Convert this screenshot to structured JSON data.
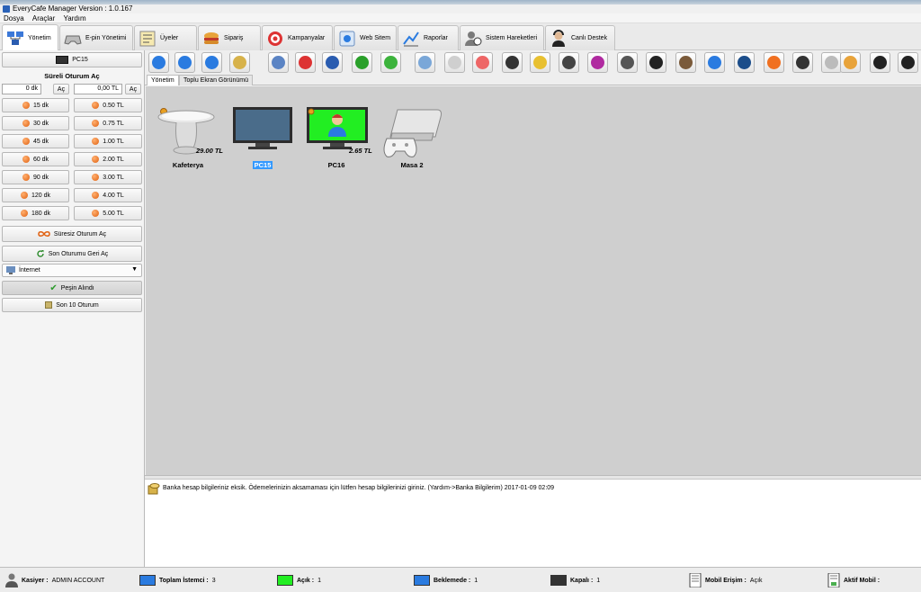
{
  "window": {
    "title": "EveryCafe Manager Version : 1.0.167"
  },
  "menu": [
    "Dosya",
    "Araçlar",
    "Yardım"
  ],
  "tabs": [
    {
      "label": "Yönetim",
      "icon": "network-icon",
      "active": true
    },
    {
      "label": "E-pin Yönetimi",
      "icon": "gamepad-icon"
    },
    {
      "label": "Üyeler",
      "icon": "member-list-icon"
    },
    {
      "label": "Sipariş",
      "icon": "burger-icon"
    },
    {
      "label": "Kampanyalar",
      "icon": "target-icon"
    },
    {
      "label": "Web Sitem",
      "icon": "web-icon"
    },
    {
      "label": "Raporlar",
      "icon": "report-icon"
    },
    {
      "label": "Sistem Hareketleri",
      "icon": "users-activity-icon"
    },
    {
      "label": "Canlı Destek",
      "icon": "support-icon"
    }
  ],
  "left": {
    "pc_button": "PC15",
    "section_title": "Süreli Oturum Aç",
    "minutes_value": "0 dk",
    "amount_value": "0,00 TL",
    "open_label": "Aç",
    "time_buttons": [
      "15 dk",
      "30 dk",
      "45 dk",
      "60 dk",
      "90 dk",
      "120 dk",
      "180 dk"
    ],
    "money_buttons": [
      "0.50 TL",
      "0.75 TL",
      "1.00 TL",
      "2.00 TL",
      "3.00 TL",
      "4.00 TL",
      "5.00 TL"
    ],
    "unlimited_label": "Süresiz Oturum Aç",
    "restore_label": "Son Oturumu Geri Aç",
    "select_value": "İnternet",
    "paid_label": "Peşin Alındı",
    "last10_label": "Son 10 Oturum"
  },
  "subtabs": [
    "Yönetim",
    "Toplu Ekran Görünümü"
  ],
  "clients": [
    {
      "name": "Kafeterya",
      "price": "29.00 TL",
      "kind": "cafe"
    },
    {
      "name": "PC15",
      "price": "",
      "kind": "monitor-off",
      "selected": true
    },
    {
      "name": "PC16",
      "price": "2.65 TL",
      "kind": "monitor-on"
    },
    {
      "name": "Masa 2",
      "price": "",
      "kind": "console"
    }
  ],
  "log": {
    "message": "Banka hesap bilgileriniz eksik. Ödemelerinizin aksamaması için lütfen hesap bilgilerinizi giriniz. (Yardım->Banka Bilgilerim)  2017-01-09 02:09"
  },
  "status": {
    "cashier_label": "Kasiyer :",
    "cashier_value": "ADMIN ACCOUNT",
    "total_label": "Toplam İstemci :",
    "total_value": "3",
    "open_label": "Açık :",
    "open_value": "1",
    "waiting_label": "Beklemede :",
    "waiting_value": "1",
    "closed_label": "Kapalı :",
    "closed_value": "1",
    "mobile_label": "Mobil Erişim :",
    "mobile_value": "Açık",
    "active_mobile_label": "Aktif Mobil :"
  },
  "colors": {
    "open": "#22ee22",
    "waiting": "#2a7be0",
    "closed": "#333333",
    "canvas": "#cfcfcf"
  }
}
